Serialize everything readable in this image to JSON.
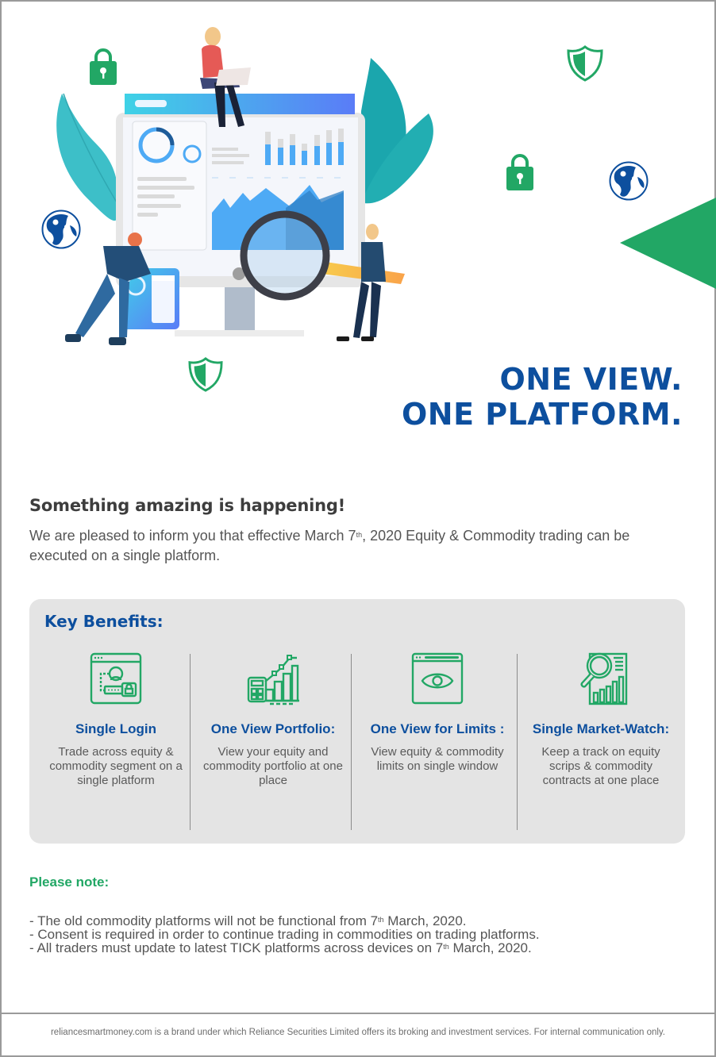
{
  "headline": {
    "line1": "ONE VIEW.",
    "line2": "ONE PLATFORM."
  },
  "intro": {
    "title": "Something amazing is happening!",
    "text_before_sup": "We are pleased to inform you that effective March 7",
    "sup": "th",
    "text_after_sup": ", 2020 Equity & Commodity trading can be executed on a single platform."
  },
  "benefits": {
    "title": "Key Benefits:",
    "items": [
      {
        "icon": "login-window-icon",
        "title": "Single Login",
        "text": "Trade across equity & commodity segment on a single platform"
      },
      {
        "icon": "portfolio-calculator-chart-icon",
        "title": "One View Portfolio:",
        "text": "View your equity and commodity portfolio at one place"
      },
      {
        "icon": "window-eye-icon",
        "title": "One View for Limits :",
        "text": "View equity & commodity limits on single window"
      },
      {
        "icon": "magnifier-report-icon",
        "title": "Single Market-Watch:",
        "text": "Keep a track on equity scrips & commodity contracts at one place"
      }
    ]
  },
  "notes": {
    "title": "Please note:",
    "items": [
      {
        "before": "- The old commodity platforms will not be functional from 7",
        "sup": "th",
        "after": " March, 2020."
      },
      {
        "before": "- Consent is required in order to continue trading in commodities on trading platforms.",
        "sup": "",
        "after": ""
      },
      {
        "before": "- All traders must update to latest TICK platforms across devices on 7",
        "sup": "th",
        "after": " March, 2020."
      }
    ]
  },
  "footer": {
    "text": "reliancesmartmoney.com is a brand under which Reliance Securities Limited offers its broking and investment services. For internal communication only."
  },
  "colors": {
    "brand_blue": "#0d4f9e",
    "accent_green": "#22a765",
    "panel_gray": "#e4e4e4"
  }
}
